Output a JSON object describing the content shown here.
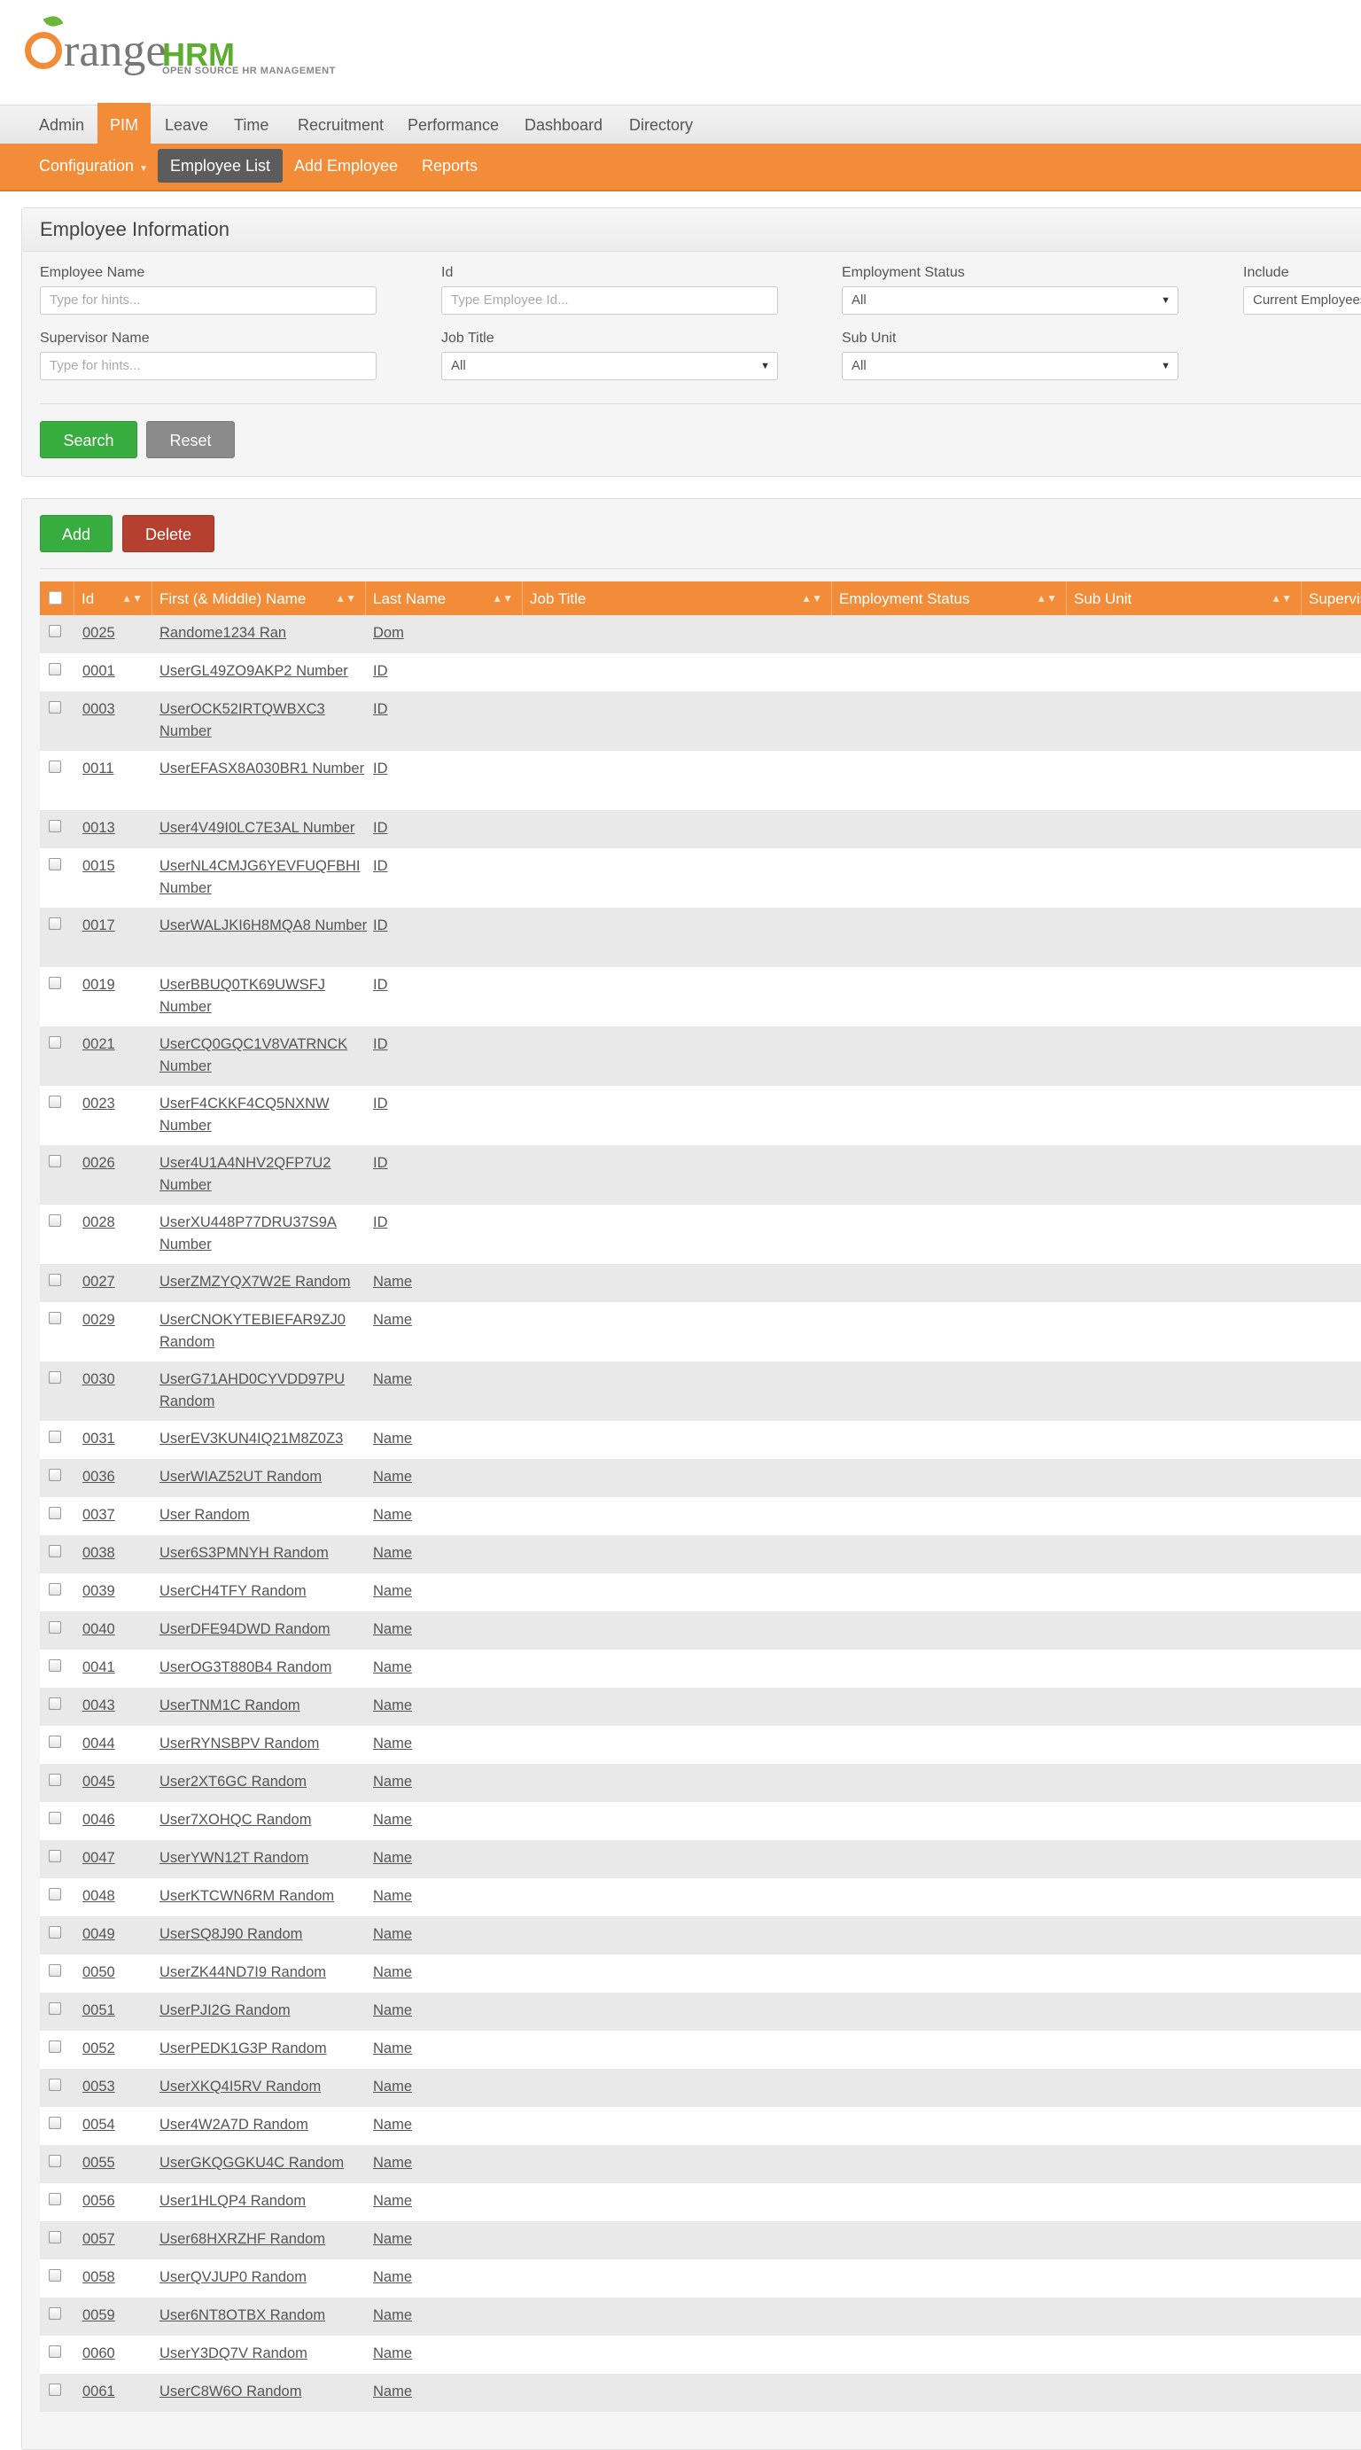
{
  "branding": {
    "logo_word": "range",
    "logo_hrm": "HRM",
    "tagline": "OPEN SOURCE HR MANAGEMENT"
  },
  "main_menu": [
    "Admin",
    "PIM",
    "Leave",
    "Time",
    "Recruitment",
    "Performance",
    "Dashboard",
    "Directory"
  ],
  "sub_menu": {
    "configuration": "Configuration",
    "employee_list": "Employee List",
    "add_employee": "Add Employee",
    "reports": "Reports"
  },
  "search": {
    "title": "Employee Information",
    "employee_name_label": "Employee Name",
    "employee_name_placeholder": "Type for hints...",
    "id_label": "Id",
    "id_placeholder": "Type Employee Id...",
    "employment_status_label": "Employment Status",
    "employment_status_value": "All",
    "include_label": "Include",
    "include_value": "Current Employees Only",
    "supervisor_label": "Supervisor Name",
    "supervisor_placeholder": "Type for hints...",
    "job_title_label": "Job Title",
    "job_title_value": "All",
    "sub_unit_label": "Sub Unit",
    "sub_unit_value": "All",
    "search_button": "Search",
    "reset_button": "Reset"
  },
  "list": {
    "add_button": "Add",
    "delete_button": "Delete",
    "columns": [
      "Id",
      "First (& Middle) Name",
      "Last Name",
      "Job Title",
      "Employment Status",
      "Sub Unit",
      "Supervisor"
    ],
    "rows": [
      {
        "id": "0025",
        "first": "Randome1234 Ran",
        "last": "Dom"
      },
      {
        "id": "0001",
        "first": "UserGL49ZO9AKP2 Number",
        "last": "ID"
      },
      {
        "id": "0003",
        "first": "UserOCK52IRTQWBXC3 Number",
        "last": "ID"
      },
      {
        "id": "0011",
        "first": "UserEFASX8A030BR1 Number",
        "last": "ID"
      },
      {
        "id": "0013",
        "first": "User4V49I0LC7E3AL Number",
        "last": "ID"
      },
      {
        "id": "0015",
        "first": "UserNL4CMJG6YEVFUQFBHI Number",
        "last": "ID"
      },
      {
        "id": "0017",
        "first": "UserWALJKI6H8MQA8 Number",
        "last": "ID"
      },
      {
        "id": "0019",
        "first": "UserBBUQ0TK69UWSFJ Number",
        "last": "ID"
      },
      {
        "id": "0021",
        "first": "UserCQ0GQC1V8VATRNCK Number",
        "last": "ID"
      },
      {
        "id": "0023",
        "first": "UserF4CKKF4CQ5NXNW Number",
        "last": "ID"
      },
      {
        "id": "0026",
        "first": "User4U1A4NHV2QFP7U2 Number",
        "last": "ID"
      },
      {
        "id": "0028",
        "first": "UserXU448P77DRU37S9A Number",
        "last": "ID"
      },
      {
        "id": "0027",
        "first": "UserZMZYQX7W2E Random",
        "last": "Name"
      },
      {
        "id": "0029",
        "first": "UserCNOKYTEBIEFAR9ZJ0 Random",
        "last": "Name"
      },
      {
        "id": "0030",
        "first": "UserG71AHD0CYVDD97PU Random",
        "last": "Name"
      },
      {
        "id": "0031",
        "first": "UserEV3KUN4IQ21M8Z0Z3",
        "last": "Name"
      },
      {
        "id": "0036",
        "first": "UserWIAZ52UT Random",
        "last": "Name"
      },
      {
        "id": "0037",
        "first": "User Random",
        "last": "Name"
      },
      {
        "id": "0038",
        "first": "User6S3PMNYH Random",
        "last": "Name"
      },
      {
        "id": "0039",
        "first": "UserCH4TFY Random",
        "last": "Name"
      },
      {
        "id": "0040",
        "first": "UserDFE94DWD Random",
        "last": "Name"
      },
      {
        "id": "0041",
        "first": "UserOG3T880B4 Random",
        "last": "Name"
      },
      {
        "id": "0043",
        "first": "UserTNM1C Random",
        "last": "Name"
      },
      {
        "id": "0044",
        "first": "UserRYNSBPV Random",
        "last": "Name"
      },
      {
        "id": "0045",
        "first": "User2XT6GC Random",
        "last": "Name"
      },
      {
        "id": "0046",
        "first": "User7XOHQC Random",
        "last": "Name"
      },
      {
        "id": "0047",
        "first": "UserYWN12T Random",
        "last": "Name"
      },
      {
        "id": "0048",
        "first": "UserKTCWN6RM Random",
        "last": "Name"
      },
      {
        "id": "0049",
        "first": "UserSQ8J90 Random",
        "last": "Name"
      },
      {
        "id": "0050",
        "first": "UserZK44ND7I9 Random",
        "last": "Name"
      },
      {
        "id": "0051",
        "first": "UserPJI2G Random",
        "last": "Name"
      },
      {
        "id": "0052",
        "first": "UserPEDK1G3P Random",
        "last": "Name"
      },
      {
        "id": "0053",
        "first": "UserXKQ4I5RV Random",
        "last": "Name"
      },
      {
        "id": "0054",
        "first": "User4W2A7D Random",
        "last": "Name"
      },
      {
        "id": "0055",
        "first": "UserGKQGGKU4C Random",
        "last": "Name"
      },
      {
        "id": "0056",
        "first": "User1HLQP4 Random",
        "last": "Name"
      },
      {
        "id": "0057",
        "first": "User68HXRZHF Random",
        "last": "Name"
      },
      {
        "id": "0058",
        "first": "UserQVJUP0 Random",
        "last": "Name"
      },
      {
        "id": "0059",
        "first": "User6NT8OTBX Random",
        "last": "Name"
      },
      {
        "id": "0060",
        "first": "UserY3DQ7V Random",
        "last": "Name"
      },
      {
        "id": "0061",
        "first": "UserC8W6O Random",
        "last": "Name"
      }
    ]
  }
}
